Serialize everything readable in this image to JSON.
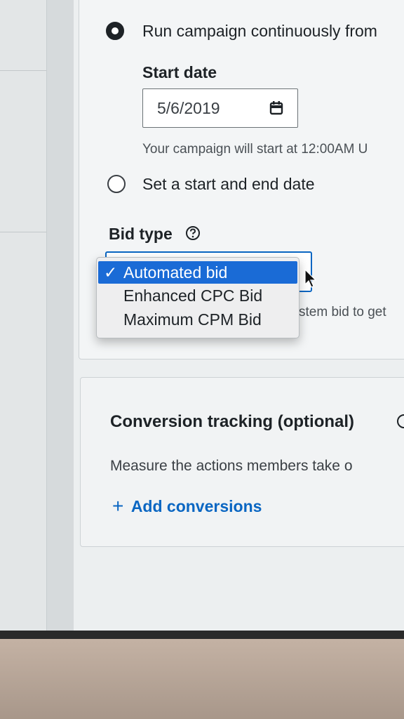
{
  "schedule": {
    "option_continuous": "Run campaign continuously from",
    "start_date_label": "Start date",
    "start_date_value": "5/6/2019",
    "start_hint": "Your campaign will start at 12:00AM U",
    "option_start_end": "Set a start and end date"
  },
  "bid": {
    "label": "Bid type",
    "options": [
      {
        "check": "✓",
        "label": "Automated bid"
      },
      {
        "check": "",
        "label": "Enhanced CPC Bid"
      },
      {
        "check": "",
        "label": "Maximum CPM Bid"
      }
    ],
    "partial_hint": "stem bid to get"
  },
  "conversion": {
    "title": "Conversion tracking (optional)",
    "description": "Measure the actions members take o",
    "add_icon": "+",
    "add_label": "Add conversions"
  },
  "icons": {
    "calendar": "calendar-icon",
    "help": "question-circle-icon",
    "cursor": "mouse-pointer-icon"
  },
  "colors": {
    "accent": "#0a66c2",
    "selected": "#1a6bd6",
    "text": "#1d2226"
  }
}
